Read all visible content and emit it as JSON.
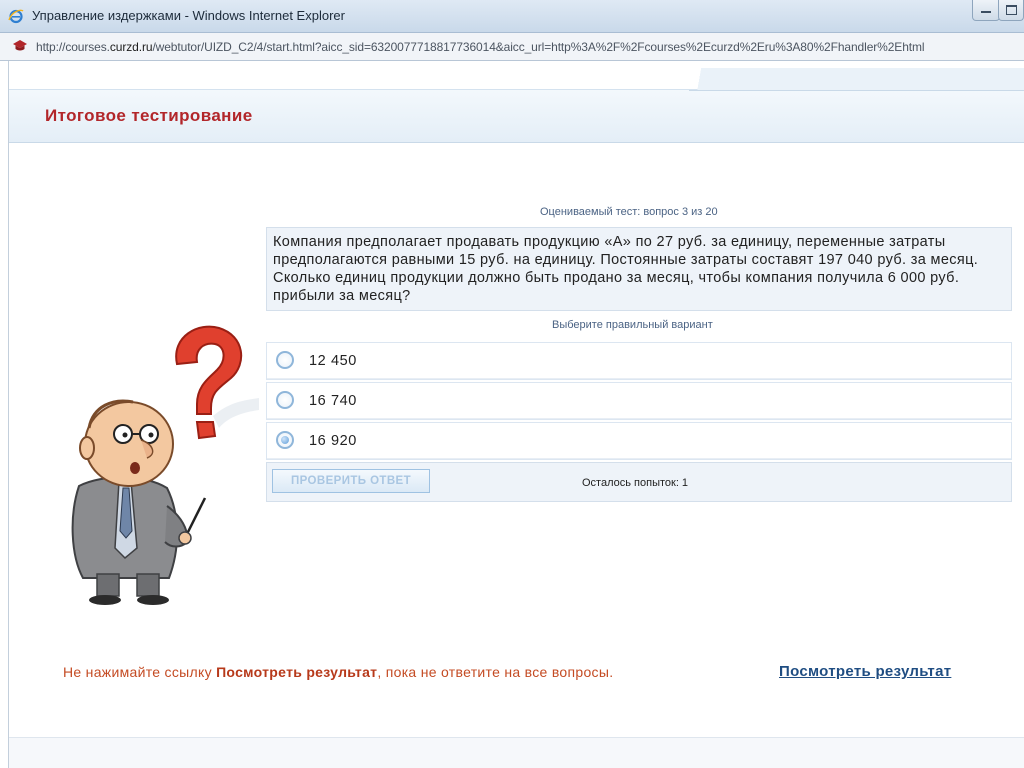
{
  "window": {
    "title": "Управление издержками - Windows Internet Explorer",
    "url_prefix": "http://courses.",
    "url_domain": "curzd.ru",
    "url_rest": "/webtutor/UIZD_C2/4/start.html?aicc_sid=6320077718817736014&aicc_url=http%3A%2F%2Fcourses%2Ecurzd%2Eru%3A80%2Fhandler%2Ehtml"
  },
  "page": {
    "title": "Итоговое тестирование"
  },
  "question": {
    "counter": "Оцениваемый тест: вопрос 3 из 20",
    "text": "Компания предполагает продавать продукцию «А» по 27 руб. за единицу, переменные затраты предполагаются равными 15 руб. на единицу. Постоянные затраты составят 197 040 руб. за месяц. Сколько единиц продукции должно быть продано за месяц, чтобы компания получила 6 000 руб. прибыли за месяц?",
    "hint": "Выберите правильный вариант",
    "options": [
      {
        "label": "12 450",
        "checked": false
      },
      {
        "label": "16 740",
        "checked": false
      },
      {
        "label": "16 920",
        "checked": true
      }
    ],
    "check_button": "ПРОВЕРИТЬ ОТВЕТ",
    "attempts_left": "Осталось попыток: 1"
  },
  "footer": {
    "warning_prefix": "Не нажимайте ссылку ",
    "warning_strong": "Посмотреть результат",
    "warning_suffix": ", пока не ответите на все вопросы.",
    "result_link": "Посмотреть результат"
  },
  "colors": {
    "title_red": "#b2262a",
    "link_blue": "#1f4d82",
    "warning_orange": "#c44b23",
    "question_bg": "#eef3f9"
  },
  "icons": [
    "ie-icon",
    "minimize-icon",
    "maximize-icon",
    "page-icon",
    "question-mark-icon",
    "man-illustration"
  ]
}
